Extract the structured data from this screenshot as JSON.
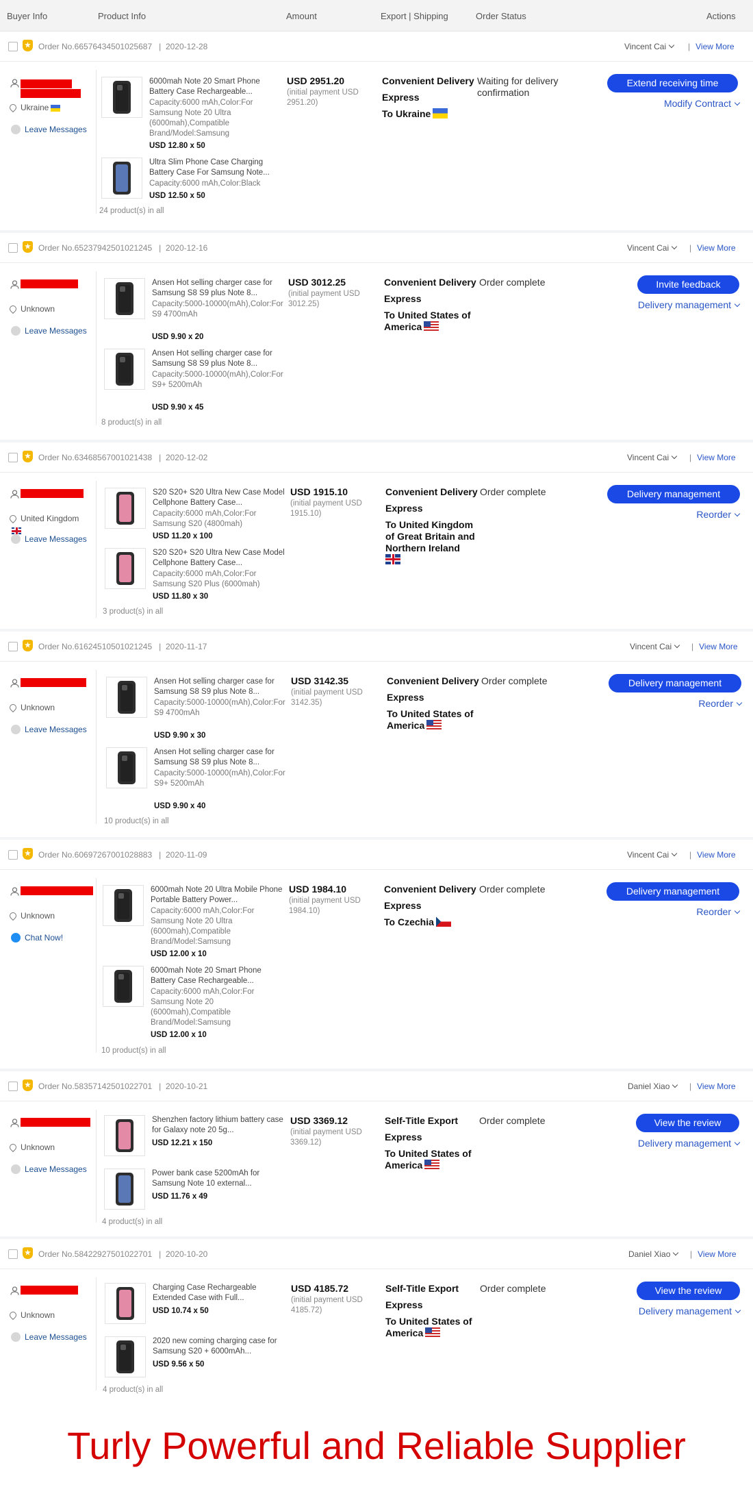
{
  "table_header": {
    "buyer_info": "Buyer Info",
    "product_info": "Product Info",
    "amount": "Amount",
    "export_shipping": "Export | Shipping",
    "order_status": "Order Status",
    "actions": "Actions"
  },
  "orders": [
    {
      "order_no": "Order No.66576434501025687",
      "date": "2020-12-28",
      "seller": "Vincent Cai",
      "view_more": "View More",
      "buyer_location": "Ukraine",
      "buyer_message": "Leave Messages",
      "products": [
        {
          "title": "6000mah Note 20 Smart Phone Battery Case Rechargeable...",
          "spec": "Capacity:6000 mAh,Color:For Samsung Note 20 Ultra (6000mah),Compatible Brand/Model:Samsung",
          "price": "USD 12.80 x 50"
        },
        {
          "title": "Ultra Slim Phone Case Charging Battery Case For Samsung Note...",
          "spec": "Capacity:6000 mAh,Color:Black",
          "price": "USD 12.50 x 50"
        }
      ],
      "product_count": "24 product(s) in all",
      "amount": "USD 2951.20",
      "initial_payment": "(initial payment USD 2951.20)",
      "shipping_line1": "Convenient Delivery",
      "shipping_line2": "Express",
      "destination": "To Ukraine",
      "status": "Waiting for delivery confirmation",
      "action_button": "Extend receiving time",
      "action_link": "Modify Contract"
    },
    {
      "order_no": "Order No.65237942501021245",
      "date": "2020-12-16",
      "seller": "Vincent Cai",
      "view_more": "View More",
      "buyer_location": "Unknown",
      "buyer_message": "Leave Messages",
      "products": [
        {
          "title": "Ansen Hot selling charger case for Samsung S8 S9 plus Note 8...",
          "spec": "Capacity:5000-10000(mAh),Color:For S9 4700mAh",
          "price": "USD 9.90 x 20"
        },
        {
          "title": "Ansen Hot selling charger case for Samsung S8 S9 plus Note 8...",
          "spec": "Capacity:5000-10000(mAh),Color:For S9+ 5200mAh",
          "price": "USD 9.90 x 45"
        }
      ],
      "product_count": "8 product(s) in all",
      "amount": "USD 3012.25",
      "initial_payment": "(initial payment USD 3012.25)",
      "shipping_line1": "Convenient Delivery",
      "shipping_line2": "Express",
      "destination": "To United States of America",
      "status": "Order complete",
      "action_button": "Invite feedback",
      "action_link": "Delivery management"
    },
    {
      "order_no": "Order No.63468567001021438",
      "date": "2020-12-02",
      "seller": "Vincent Cai",
      "view_more": "View More",
      "buyer_location": "United Kingdom",
      "buyer_message": "Leave Messages",
      "products": [
        {
          "title": "S20 S20+ S20 Ultra New Case Model Cellphone Battery Case...",
          "spec": "Capacity:6000 mAh,Color:For Samsung S20 (4800mah)",
          "price": "USD 11.20 x 100"
        },
        {
          "title": "S20 S20+ S20 Ultra New Case Model Cellphone Battery Case...",
          "spec": "Capacity:6000 mAh,Color:For Samsung S20 Plus (6000mah)",
          "price": "USD 11.80 x 30"
        }
      ],
      "product_count": "3 product(s) in all",
      "amount": "USD 1915.10",
      "initial_payment": "(initial payment USD 1915.10)",
      "shipping_line1": "Convenient Delivery",
      "shipping_line2": "Express",
      "destination": "To United Kingdom of Great Britain and Northern Ireland",
      "status": "Order complete",
      "action_button": "Delivery management",
      "action_link": "Reorder"
    },
    {
      "order_no": "Order No.61624510501021245",
      "date": "2020-11-17",
      "seller": "Vincent Cai",
      "view_more": "View More",
      "buyer_location": "Unknown",
      "buyer_message": "Leave Messages",
      "products": [
        {
          "title": "Ansen Hot selling charger case for Samsung S8 S9 plus Note 8...",
          "spec": "Capacity:5000-10000(mAh),Color:For S9 4700mAh",
          "price": "USD 9.90 x 30"
        },
        {
          "title": "Ansen Hot selling charger case for Samsung S8 S9 plus Note 8...",
          "spec": "Capacity:5000-10000(mAh),Color:For S9+ 5200mAh",
          "price": "USD 9.90 x 40"
        }
      ],
      "product_count": "10 product(s) in all",
      "amount": "USD 3142.35",
      "initial_payment": "(initial payment USD 3142.35)",
      "shipping_line1": "Convenient Delivery",
      "shipping_line2": "Express",
      "destination": "To United States of America",
      "status": "Order complete",
      "action_button": "Delivery management",
      "action_link": "Reorder"
    },
    {
      "order_no": "Order No.60697267001028883",
      "date": "2020-11-09",
      "seller": "Vincent Cai",
      "view_more": "View More",
      "buyer_location": "Unknown",
      "buyer_message": "Chat Now!",
      "products": [
        {
          "title": "6000mah Note 20 Ultra Mobile Phone Portable Battery Power...",
          "spec": "Capacity:6000 mAh,Color:For Samsung Note 20 Ultra (6000mah),Compatible Brand/Model:Samsung",
          "price": "USD 12.00 x 10"
        },
        {
          "title": "6000mah Note 20 Smart Phone Battery Case Rechargeable...",
          "spec": "Capacity:6000 mAh,Color:For Samsung Note 20 (6000mah),Compatible Brand/Model:Samsung",
          "price": "USD 12.00 x 10"
        }
      ],
      "product_count": "10 product(s) in all",
      "amount": "USD 1984.10",
      "initial_payment": "(initial payment USD 1984.10)",
      "shipping_line1": "Convenient Delivery",
      "shipping_line2": "Express",
      "destination": "To Czechia",
      "status": "Order complete",
      "action_button": "Delivery management",
      "action_link": "Reorder"
    },
    {
      "order_no": "Order No.58357142501022701",
      "date": "2020-10-21",
      "seller": "Daniel Xiao",
      "view_more": "View More",
      "buyer_location": "Unknown",
      "buyer_message": "Leave Messages",
      "products": [
        {
          "title": "Shenzhen factory lithium battery case for Galaxy note 20 5g...",
          "spec": "",
          "price": "USD 12.21 x 150"
        },
        {
          "title": "Power bank case 5200mAh for Samsung Note 10 external...",
          "spec": "",
          "price": "USD 11.76 x 49"
        }
      ],
      "product_count": "4 product(s) in all",
      "amount": "USD 3369.12",
      "initial_payment": "(initial payment USD 3369.12)",
      "shipping_line1": "Self-Title Export",
      "shipping_line2": "Express",
      "destination": "To United States of America",
      "status": "Order complete",
      "action_button": "View the review",
      "action_link": "Delivery management"
    },
    {
      "order_no": "Order No.58422927501022701",
      "date": "2020-10-20",
      "seller": "Daniel Xiao",
      "view_more": "View More",
      "buyer_location": "Unknown",
      "buyer_message": "Leave Messages",
      "products": [
        {
          "title": "Charging Case Rechargeable Extended Case with Full...",
          "spec": "",
          "price": "USD 10.74 x 50"
        },
        {
          "title": "2020 new coming charging case for Samsung S20 + 6000mAh...",
          "spec": "",
          "price": "USD 9.56 x 50"
        }
      ],
      "product_count": "4 product(s) in all",
      "amount": "USD 4185.72",
      "initial_payment": "(initial payment USD 4185.72)",
      "shipping_line1": "Self-Title Export",
      "shipping_line2": "Express",
      "destination": "To United States of America",
      "status": "Order complete",
      "action_button": "View the review",
      "action_link": "Delivery management"
    }
  ],
  "slogan": "Turly Powerful and Reliable Supplier",
  "colors": {
    "accent": "#1a49e6",
    "link": "#2a56c6",
    "slogan": "#d40000",
    "redaction": "#ee0000"
  }
}
